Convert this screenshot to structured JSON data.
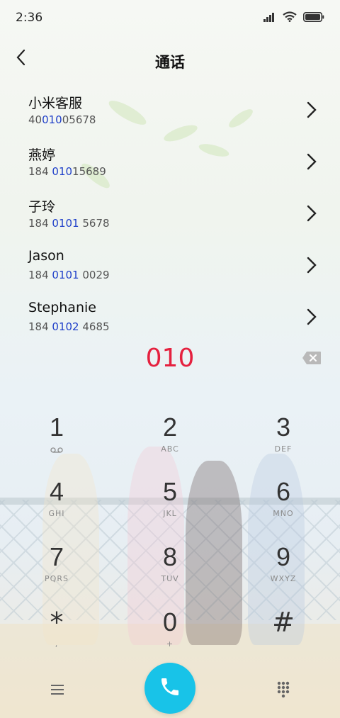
{
  "status_bar": {
    "time": "2:36"
  },
  "header": {
    "title": "通话"
  },
  "contacts": [
    {
      "name": "小米客服",
      "number_pre": "40",
      "number_match": "010",
      "number_post": "05678"
    },
    {
      "name": "燕婷",
      "number_pre": "184 ",
      "number_match": "010",
      "number_post": "15689"
    },
    {
      "name": "子玲",
      "number_pre": "184 ",
      "number_match": "0101",
      "number_post": " 5678"
    },
    {
      "name": "Jason",
      "number_pre": "184 ",
      "number_match": "0101",
      "number_post": " 0029"
    },
    {
      "name": "Stephanie",
      "number_pre": "184 ",
      "number_match": "0102",
      "number_post": " 4685"
    }
  ],
  "dialer": {
    "digits": "010"
  },
  "keypad": {
    "k1": {
      "digit": "1",
      "letters": ""
    },
    "k2": {
      "digit": "2",
      "letters": "ABC"
    },
    "k3": {
      "digit": "3",
      "letters": "DEF"
    },
    "k4": {
      "digit": "4",
      "letters": "GHI"
    },
    "k5": {
      "digit": "5",
      "letters": "JKL"
    },
    "k6": {
      "digit": "6",
      "letters": "MNO"
    },
    "k7": {
      "digit": "7",
      "letters": "PQRS"
    },
    "k8": {
      "digit": "8",
      "letters": "TUV"
    },
    "k9": {
      "digit": "9",
      "letters": "WXYZ"
    },
    "kstar": {
      "digit": "*",
      "letters": ","
    },
    "k0": {
      "digit": "0",
      "letters": "+"
    },
    "khash": {
      "digit": "#",
      "letters": ""
    }
  },
  "colors": {
    "accent_red": "#e5213f",
    "match_blue": "#1f3fc9",
    "call_button": "#18c3e8"
  },
  "icons": [
    "signal-icon",
    "wifi-icon",
    "battery-icon",
    "back-arrow-icon",
    "chevron-right-icon",
    "backspace-icon",
    "voicemail-icon",
    "menu-icon",
    "phone-icon",
    "dialpad-icon"
  ]
}
